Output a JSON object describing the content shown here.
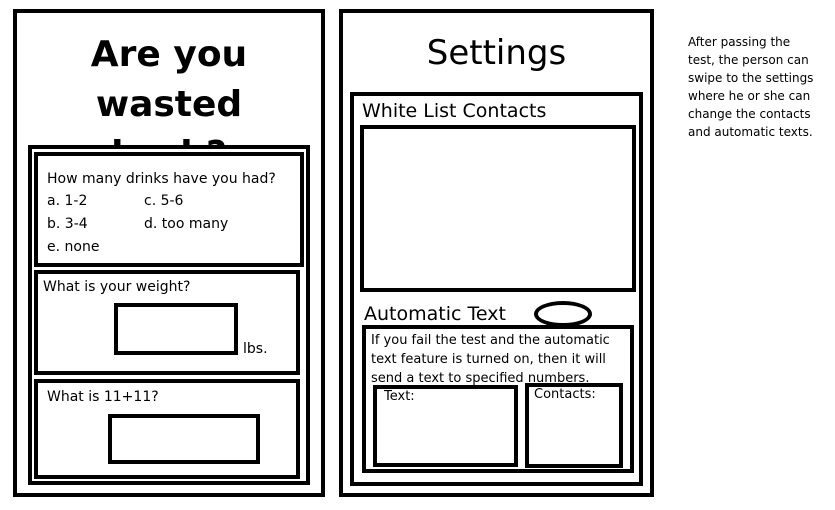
{
  "test_screen": {
    "title_line1": "Are you wasted",
    "title_line2": "bruh?",
    "drinks": {
      "question": "How many drinks have you had?",
      "options": [
        "a. 1-2",
        "c. 5-6",
        "b. 3-4",
        "d. too many",
        "e. none"
      ]
    },
    "weight": {
      "question": "What is your weight?",
      "unit": "lbs.",
      "value": ""
    },
    "math": {
      "question": "What is 11+11?",
      "value": ""
    }
  },
  "settings_screen": {
    "title": "Settings",
    "whitelist_label": "White List Contacts",
    "auto_text_label": "Automatic Text",
    "auto_text_description": "If you fail the test and the automatic text feature is turned on, then it will send a text to specified numbers.",
    "text_label": "Text:",
    "contacts_label": "Contacts:"
  },
  "annotation": {
    "note": "After passing the test, the person can swipe to the settings where he or she can change the contacts and automatic texts."
  }
}
